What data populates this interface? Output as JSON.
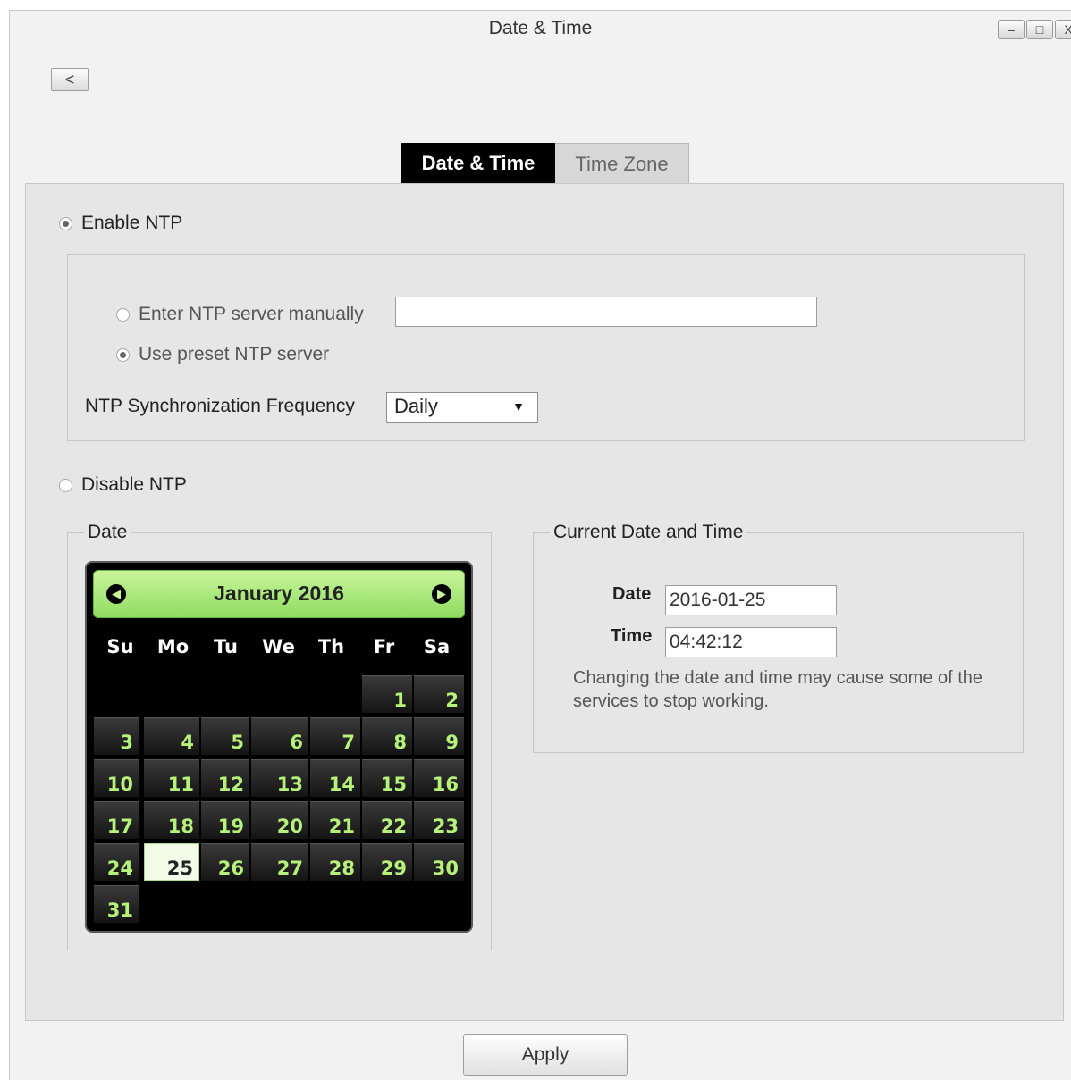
{
  "window": {
    "title": "Date & Time",
    "minimize_glyph": "–",
    "maximize_glyph": "□",
    "close_glyph": "X"
  },
  "nav": {
    "back_glyph": "<"
  },
  "tabs": [
    {
      "label": "Date & Time",
      "active": true
    },
    {
      "label": "Time Zone",
      "active": false
    }
  ],
  "ntp": {
    "enable_label": "Enable NTP",
    "enable_checked": true,
    "manual_label": "Enter NTP server manually",
    "manual_checked": false,
    "manual_value": "",
    "preset_label": "Use preset NTP server",
    "preset_checked": true,
    "frequency_label": "NTP Synchronization Frequency",
    "frequency_value": "Daily",
    "disable_label": "Disable NTP",
    "disable_checked": false
  },
  "date_group": {
    "legend": "Date",
    "calendar": {
      "month_label": "January 2016",
      "prev_icon": "◀",
      "next_icon": "▶",
      "weekdays": [
        "Su",
        "Mo",
        "Tu",
        "We",
        "Th",
        "Fr",
        "Sa"
      ],
      "first_weekday_index": 5,
      "days_in_month": 31,
      "selected_day": 25
    }
  },
  "current": {
    "legend": "Current Date and Time",
    "date_label": "Date",
    "date_value": "2016-01-25",
    "time_label": "Time",
    "time_value": "04:42:12",
    "note": "Changing the date and time may cause some of the services to stop working."
  },
  "footer": {
    "apply_label": "Apply"
  }
}
